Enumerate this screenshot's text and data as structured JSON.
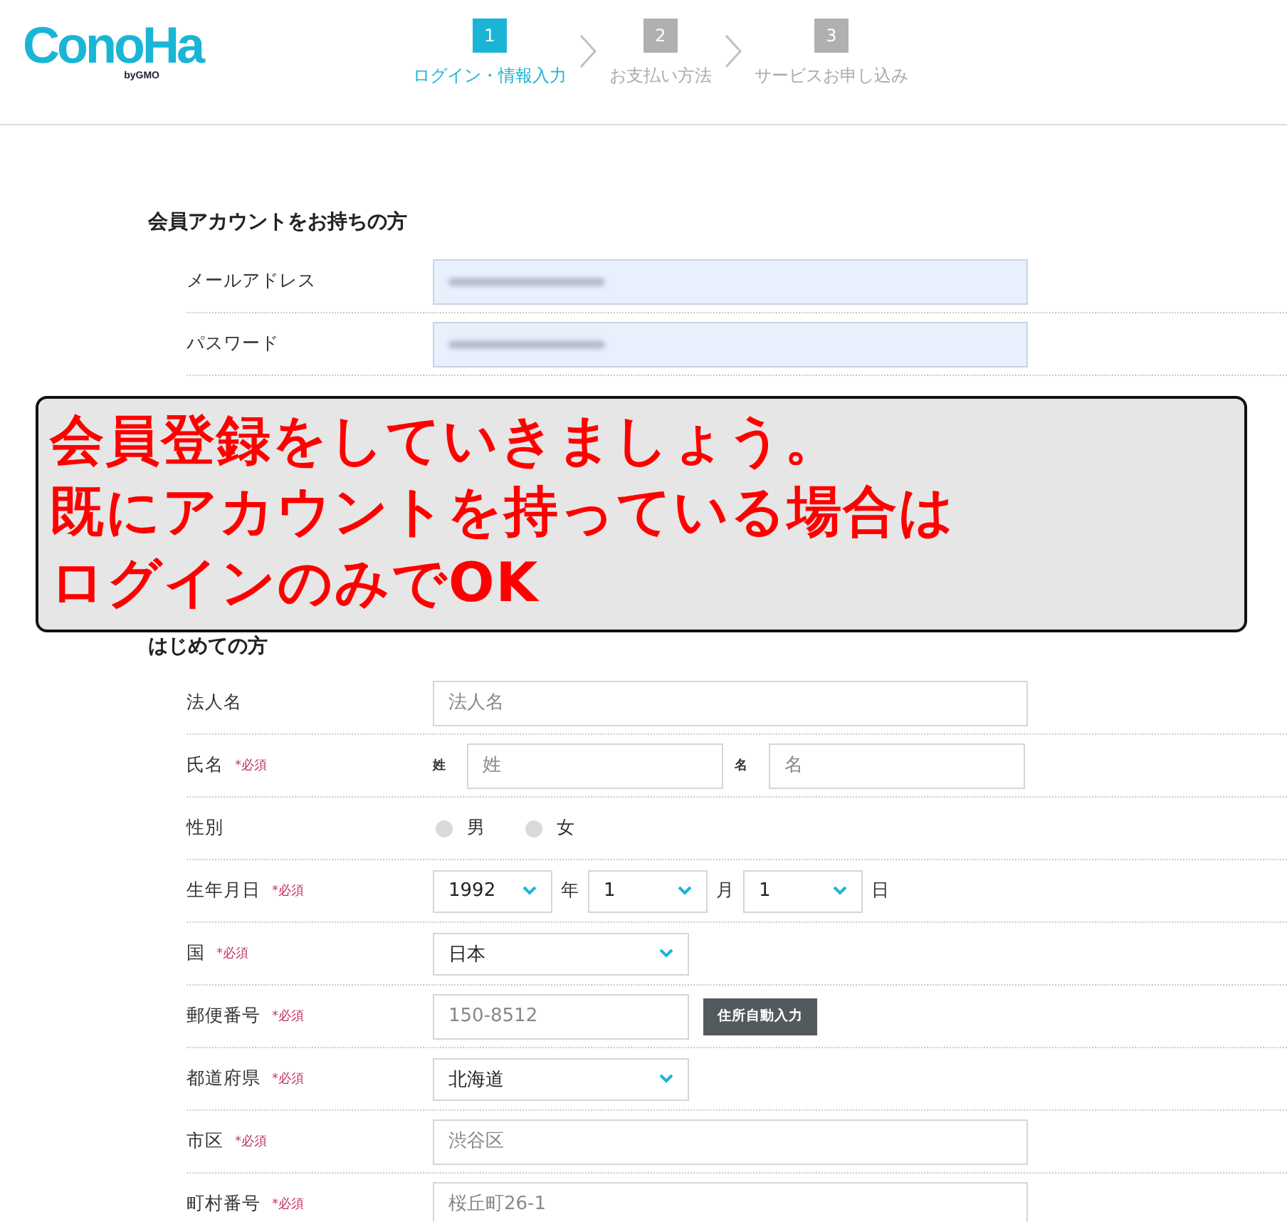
{
  "header": {
    "logo": {
      "text": "ConoHa",
      "byline": "byGMO"
    },
    "steps": [
      {
        "number": "1",
        "label": "ログイン・情報入力",
        "selected": true
      },
      {
        "number": "2",
        "label": "お支払い方法",
        "selected": false
      },
      {
        "number": "3",
        "label": "サービスお申し込み",
        "selected": false
      }
    ]
  },
  "login_section": {
    "title": "会員アカウントをお持ちの方",
    "rows": [
      {
        "kind": "redacted",
        "label": "メールアドレス"
      },
      {
        "kind": "redacted",
        "label": "パスワード"
      }
    ]
  },
  "callout": {
    "lines": [
      "会員登録をしていきましょう。",
      "既にアカウントを持っている場合は",
      "ログインのみでOK"
    ]
  },
  "signup_section": {
    "title": "はじめての方",
    "rows": [
      {
        "kind": "text",
        "label": "法人名",
        "placeholder": "法人名"
      },
      {
        "kind": "name",
        "label": "氏名",
        "required_mark": "*必須",
        "parts": [
          {
            "tag": "姓",
            "placeholder": "姓"
          },
          {
            "tag": "名",
            "placeholder": "名"
          }
        ]
      },
      {
        "kind": "radio",
        "label": "性別",
        "options": [
          {
            "label": "男",
            "selected": false
          },
          {
            "label": "女",
            "selected": false
          }
        ]
      },
      {
        "kind": "date",
        "label": "生年月日",
        "required_mark": "*必須",
        "parts": [
          {
            "value": "1992",
            "unit": "年"
          },
          {
            "value": "1",
            "unit": "月"
          },
          {
            "value": "1",
            "unit": "日"
          }
        ]
      },
      {
        "kind": "select",
        "label": "国",
        "required_mark": "*必須",
        "value": "日本"
      },
      {
        "kind": "postal",
        "label": "郵便番号",
        "required_mark": "*必須",
        "placeholder": "150-8512",
        "button": "住所自動入力"
      },
      {
        "kind": "select",
        "label": "都道府県",
        "required_mark": "*必須",
        "value": "北海道"
      },
      {
        "kind": "text",
        "label": "市区",
        "required_mark": "*必須",
        "placeholder": "渋谷区"
      },
      {
        "kind": "text",
        "label": "町村番号",
        "required_mark": "*必須",
        "placeholder": "桜丘町26-1"
      }
    ]
  }
}
